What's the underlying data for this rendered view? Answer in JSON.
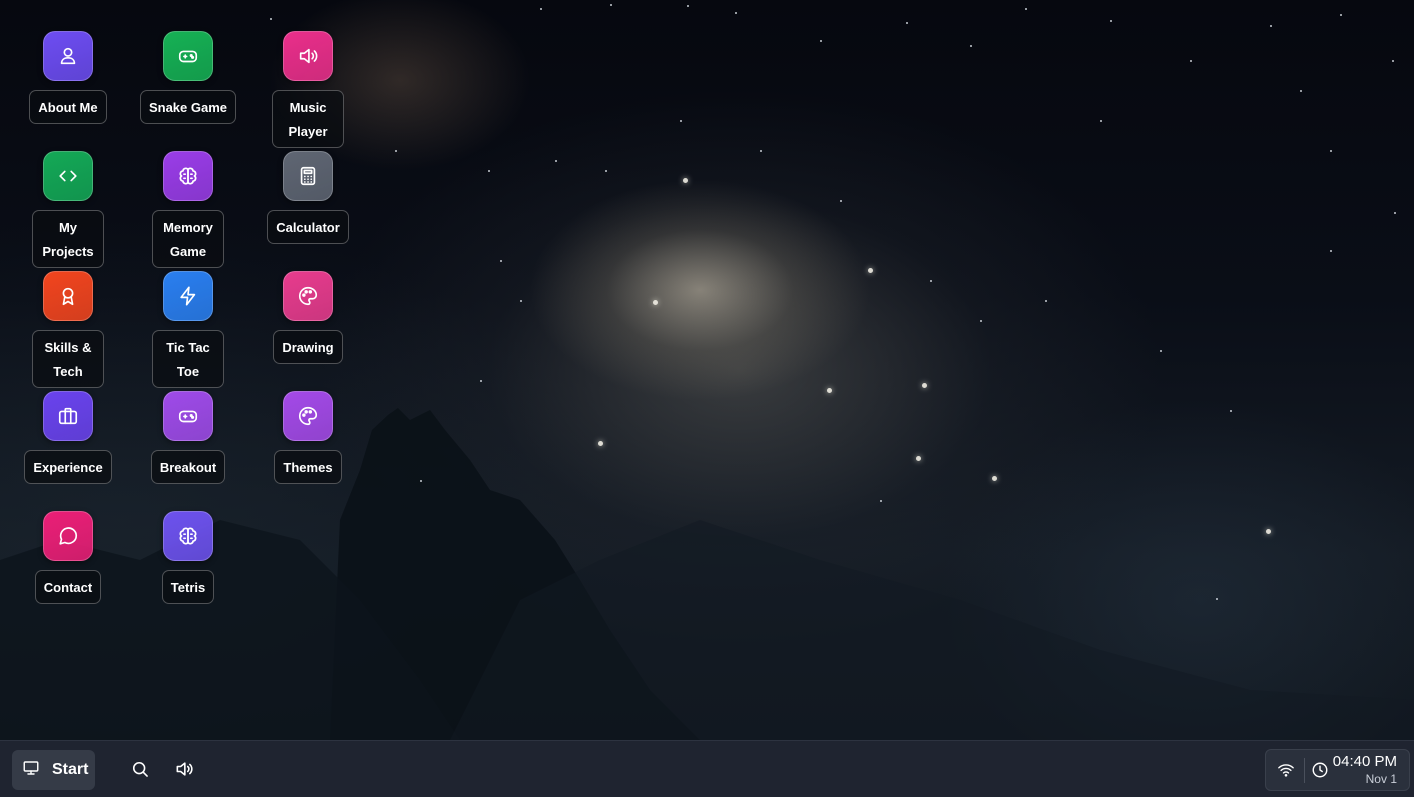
{
  "desktop": {
    "icons": [
      {
        "label": "About Me",
        "icon": "user-icon",
        "color": "#6d4df2"
      },
      {
        "label": "Snake Game",
        "icon": "gamepad-icon",
        "color": "#16b155"
      },
      {
        "label": "Music Player",
        "icon": "speaker-icon",
        "color": "#ea2f8b"
      },
      {
        "label": "My Projects",
        "icon": "code-icon",
        "color": "#14a957"
      },
      {
        "label": "Memory Game",
        "icon": "brain-icon",
        "color": "#9a3de8"
      },
      {
        "label": "Calculator",
        "icon": "calculator-icon",
        "color": "#5f6673"
      },
      {
        "label": "Skills & Tech",
        "icon": "award-icon",
        "color": "#f2451f"
      },
      {
        "label": "Tic Tac Toe",
        "icon": "lightning-icon",
        "color": "#2a7ff0"
      },
      {
        "label": "Drawing",
        "icon": "palette-icon",
        "color": "#e83c8e"
      },
      {
        "label": "Experience",
        "icon": "briefcase-icon",
        "color": "#6a43ee"
      },
      {
        "label": "Breakout",
        "icon": "gamepad-icon",
        "color": "#9f4be9"
      },
      {
        "label": "Themes",
        "icon": "palette-icon",
        "color": "#a44ae8"
      },
      {
        "label": "Contact",
        "icon": "chat-icon",
        "color": "#eb1f77"
      },
      {
        "label": "Tetris",
        "icon": "brain-icon",
        "color": "#6d52ee"
      }
    ]
  },
  "taskbar": {
    "start_label": "Start",
    "start_icon": "monitor-icon",
    "search_icon": "search-icon",
    "volume_icon": "speaker-icon",
    "wifi_icon": "wifi-icon",
    "clock_icon": "clock-icon",
    "time": "04:40 PM",
    "date": "Nov 1"
  }
}
